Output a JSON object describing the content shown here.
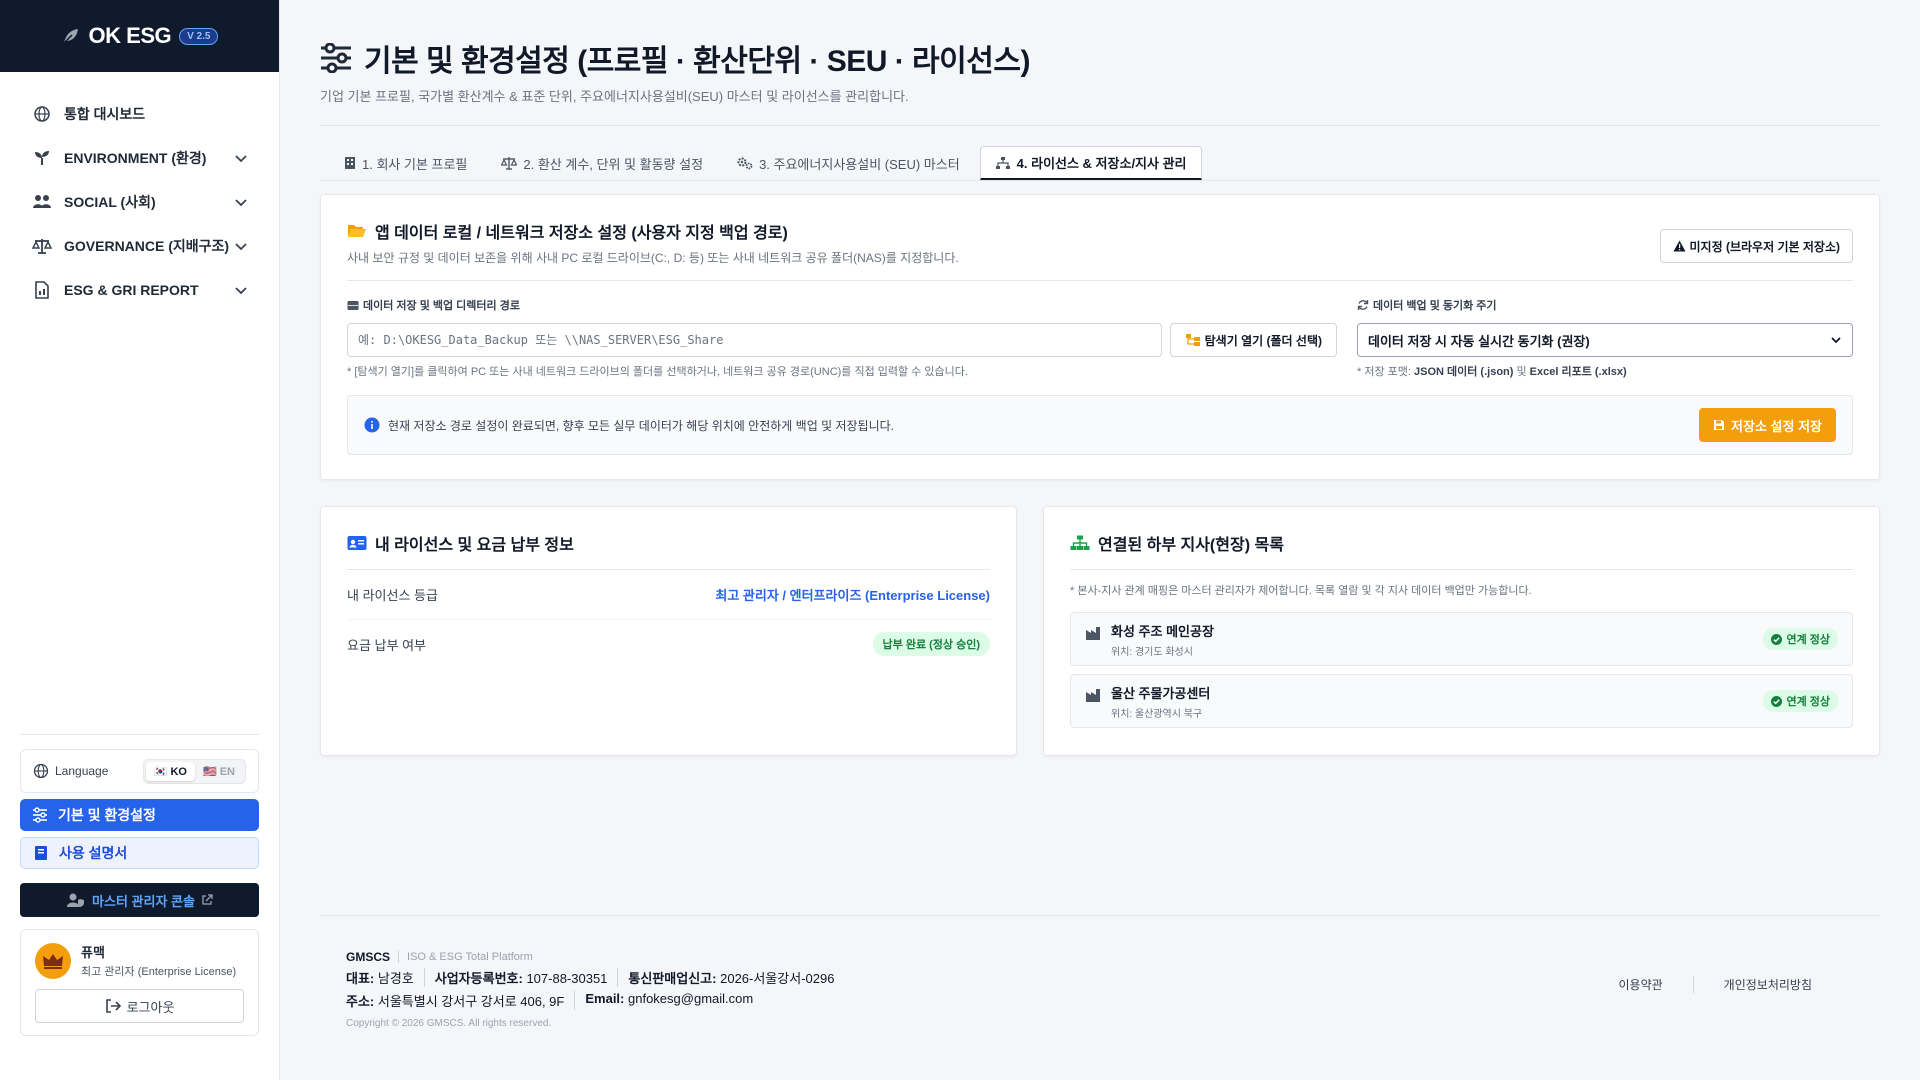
{
  "brand": {
    "name": "OK ESG",
    "version": "V 2.5"
  },
  "sidebar": {
    "items": [
      {
        "label": "통합 대시보드"
      },
      {
        "label": "ENVIRONMENT (환경)"
      },
      {
        "label": "SOCIAL (사회)"
      },
      {
        "label": "GOVERNANCE (지배구조)"
      },
      {
        "label": "ESG & GRI REPORT"
      }
    ],
    "language": {
      "label": "Language",
      "options": [
        "KO",
        "EN"
      ],
      "selected": "KO"
    },
    "settings_label": "기본 및 환경설정",
    "manual_label": "사용 설명서",
    "master_label": "마스터 관리자 콘솔",
    "user": {
      "name": "퓨맥",
      "role": "최고 관리자 (Enterprise License)"
    },
    "logout_label": "로그아웃"
  },
  "header": {
    "title": "기본 및 환경설정 (프로필 · 환산단위 · SEU · 라이선스)",
    "subtitle": "기업 기본 프로필, 국가별 환산계수 & 표준 단위, 주요에너지사용설비(SEU) 마스터 및 라이선스를 관리합니다."
  },
  "tabs": [
    {
      "label": "1. 회사 기본 프로필"
    },
    {
      "label": "2. 환산 계수, 단위 및 활동량 설정"
    },
    {
      "label": "3. 주요에너지사용설비 (SEU) 마스터"
    },
    {
      "label": "4. 라이선스 & 저장소/지사 관리"
    }
  ],
  "storage": {
    "title": "앱 데이터 로컬 / 네트워크 저장소 설정 (사용자 지정 백업 경로)",
    "subtitle": "사내 보안 규정 및 데이터 보존을 위해 사내 PC 로컬 드라이브(C:, D: 등) 또는 사내 네트워크 공유 폴더(NAS)를 지정합니다.",
    "unset_label": "미지정 (브라우저 기본 저장소)",
    "path_label": "데이터 저장 및 백업 디렉터리 경로",
    "path_placeholder": "예: D:\\OKESG_Data_Backup 또는 \\\\NAS_SERVER\\ESG_Share",
    "explorer_label": "탐색기 열기 (폴더 선택)",
    "path_help": "* [탐색기 열기]를 클릭하여 PC 또는 사내 네트워크 드라이브의 폴더를 선택하거나, 네트워크 공유 경로(UNC)를 직접 입력할 수 있습니다.",
    "sync_label": "데이터 백업 및 동기화 주기",
    "sync_value": "데이터 저장 시 자동 실시간 동기화 (권장)",
    "format_prefix": "* 저장 포맷:",
    "format_json": "JSON 데이터 (.json)",
    "format_and": "및",
    "format_excel": "Excel 리포트 (.xlsx)",
    "info_text": "현재 저장소 경로 설정이 완료되면, 향후 모든 실무 데이터가 해당 위치에 안전하게 백업 및 저장됩니다.",
    "save_label": "저장소 설정 저장"
  },
  "license": {
    "title": "내 라이선스 및 요금 납부 정보",
    "grade_label": "내 라이선스 등급",
    "grade_value": "최고 관리자 / 엔터프라이즈 (Enterprise License)",
    "payment_label": "요금 납부 여부",
    "payment_value": "납부 완료 (정상 승인)"
  },
  "branches": {
    "title": "연결된 하부 지사(현장) 목록",
    "note": "* 본사-지사 관계 매핑은 마스터 관리자가 제어합니다. 목록 열람 및 각 지사 데이터 백업만 가능합니다.",
    "items": [
      {
        "name": "화성 주조 메인공장",
        "location": "위치: 경기도 화성시",
        "status": "연계 정상"
      },
      {
        "name": "울산 주물가공센터",
        "location": "위치: 울산광역시 북구",
        "status": "연계 정상"
      }
    ]
  },
  "footer": {
    "company": "GMSCS",
    "tagline": "ISO & ESG Total Platform",
    "ceo_label": "대표:",
    "ceo": "남경호",
    "biz_label": "사업자등록번호:",
    "biz": "107-88-30351",
    "ecom_label": "통신판매업신고:",
    "ecom": "2026-서울강서-0296",
    "addr_label": "주소:",
    "addr": "서울특별시 강서구 강서로 406, 9F",
    "email_label": "Email:",
    "email": "gnfokesg@gmail.com",
    "copyright": "Copyright © 2026 GMSCS. All rights reserved.",
    "terms_label": "이용약관",
    "privacy_label": "개인정보처리방침"
  },
  "colors": {
    "primary": "#2563eb",
    "navy": "#0f1b2d",
    "accent": "#f59e0b",
    "success": "#15803d"
  }
}
